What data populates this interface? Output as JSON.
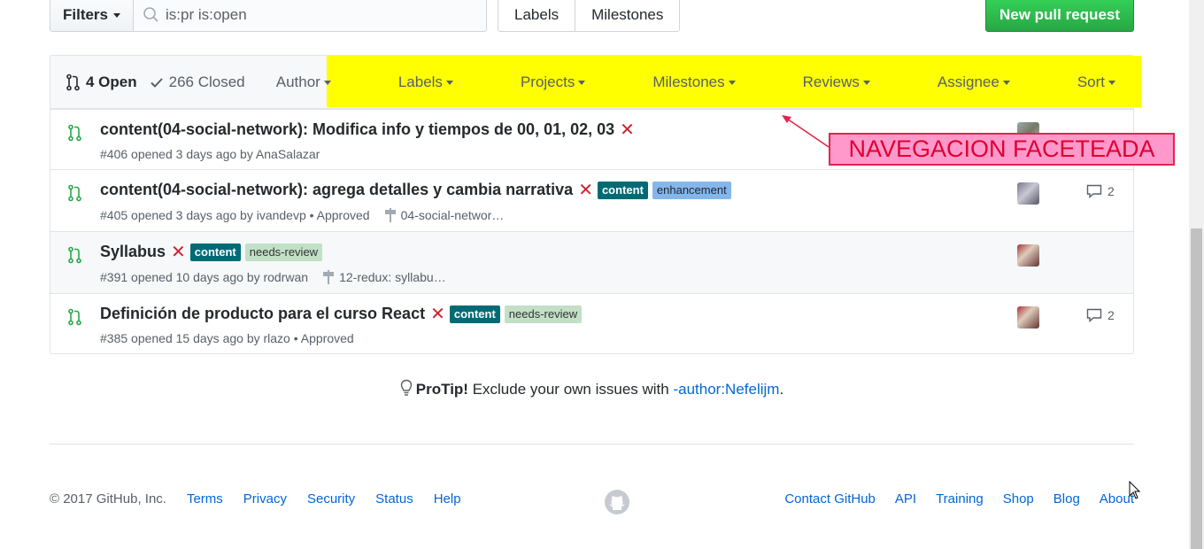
{
  "toolbar": {
    "filters_label": "Filters",
    "search_value": "is:pr is:open",
    "labels_btn": "Labels",
    "milestones_btn": "Milestones",
    "new_pr": "New pull request"
  },
  "header": {
    "open_count": "4 Open",
    "closed_count": "266 Closed",
    "facets": [
      "Author",
      "Labels",
      "Projects",
      "Milestones",
      "Reviews",
      "Assignee",
      "Sort"
    ]
  },
  "rows": [
    {
      "title": "content(04-social-network): Modifica info y tiempos de 00, 01, 02, 03",
      "meta": "#406 opened 3 days ago by AnaSalazar",
      "labels": [],
      "milestone": "",
      "comments": ""
    },
    {
      "title": "content(04-social-network): agrega detalles y cambia narrativa",
      "meta": "#405 opened 3 days ago by ivandevp • Approved",
      "labels": [
        "content",
        "enhancement"
      ],
      "milestone": "04-social-networ…",
      "comments": "2"
    },
    {
      "title": "Syllabus",
      "meta": "#391 opened 10 days ago by rodrwan",
      "labels": [
        "content",
        "needs-review"
      ],
      "milestone": "12-redux: syllabu…",
      "comments": ""
    },
    {
      "title": "Definición de producto para el curso React",
      "meta": "#385 opened 15 days ago by rlazo • Approved",
      "labels": [
        "content",
        "needs-review"
      ],
      "milestone": "",
      "comments": "2"
    }
  ],
  "annotation": "NAVEGACION FACETEADA",
  "protip": {
    "prefix": "ProTip!",
    "text": " Exclude your own issues with ",
    "link": "-author:Nefelijm",
    "suffix": "."
  },
  "footer": {
    "copyright": "© 2017 GitHub, Inc.",
    "left_links": [
      "Terms",
      "Privacy",
      "Security",
      "Status",
      "Help"
    ],
    "right_links": [
      "Contact GitHub",
      "API",
      "Training",
      "Shop",
      "Blog",
      "About"
    ]
  },
  "colors": {
    "accent_green": "#28a745",
    "link_blue": "#0366d6",
    "highlight_yellow": "#ffff00",
    "label_content": "#006b75",
    "label_enhancement": "#84b6eb",
    "label_needs_review": "#c2e0c6"
  }
}
